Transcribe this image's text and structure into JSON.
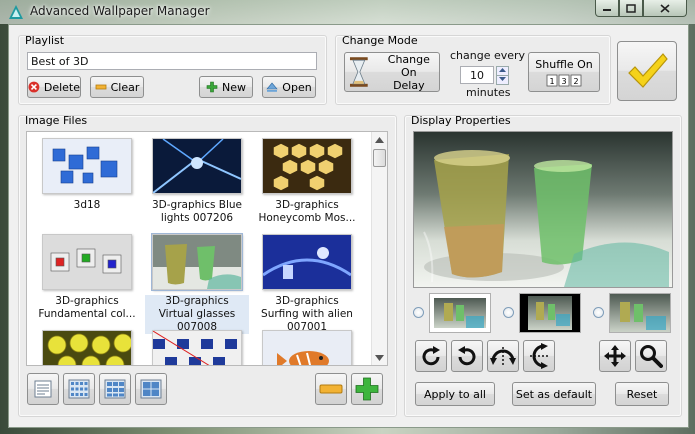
{
  "window": {
    "title": "Advanced Wallpaper Manager"
  },
  "playlist": {
    "group_label": "Playlist",
    "name_value": "Best of 3D",
    "delete_label": "Delete",
    "clear_label": "Clear",
    "new_label": "New",
    "open_label": "Open"
  },
  "change_mode": {
    "group_label": "Change Mode",
    "mode_button_line1": "Change On",
    "mode_button_line2": "Delay",
    "change_every_label": "change every",
    "interval_value": "10",
    "minutes_label": "minutes",
    "shuffle_label": "Shuffle On",
    "shuffle_icon_text": "1 3 2"
  },
  "image_files": {
    "group_label": "Image Files",
    "items": [
      {
        "caption": "3d18",
        "thumb": "blue-cubes"
      },
      {
        "caption": "3D-graphics Blue lights 007206",
        "thumb": "blue-lights"
      },
      {
        "caption": "3D-graphics Honeycomb Mos...",
        "thumb": "honeycomb"
      },
      {
        "caption": "3D-graphics Fundamental col...",
        "thumb": "color-cubes"
      },
      {
        "caption": "3D-graphics Virtual glasses 007008",
        "thumb": "glasses",
        "selected": true
      },
      {
        "caption": "3D-graphics Surfing with alien 007001",
        "thumb": "alien"
      },
      {
        "caption": "",
        "thumb": "yellow-balls"
      },
      {
        "caption": "",
        "thumb": "checker"
      },
      {
        "caption": "",
        "thumb": "fish"
      }
    ]
  },
  "display_properties": {
    "group_label": "Display Properties",
    "apply_all_label": "Apply to all",
    "set_default_label": "Set as default",
    "reset_label": "Reset"
  },
  "colors": {
    "accent_yellow": "#f5d21a",
    "selection_bg": "#dfe9f5",
    "group_bg": "#ececec"
  }
}
